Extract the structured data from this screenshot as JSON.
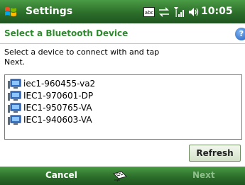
{
  "titlebar": {
    "app_title": "Settings",
    "time": "10:05"
  },
  "header": {
    "title": "Select a Bluetooth Device",
    "help_glyph": "?"
  },
  "instructions": "Select a device to connect with and tap\nNext.",
  "devices": [
    "iec1-960455-va2",
    "IEC1-970601-DP",
    "IEC1-950765-VA",
    "IEC1-940603-VA"
  ],
  "buttons": {
    "refresh": "Refresh"
  },
  "softkeys": {
    "left": "Cancel",
    "right": "Next"
  },
  "status_icons": {
    "input_mode": "abc"
  },
  "colors": {
    "accent_green": "#2e8b2e",
    "bar_green": "#2c6e2a",
    "disabled_green": "#8fbf8b"
  }
}
